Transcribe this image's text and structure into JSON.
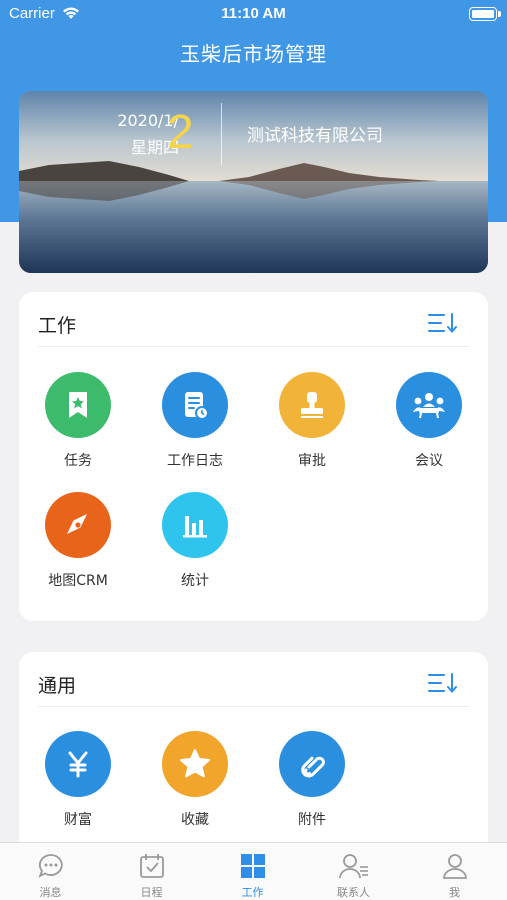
{
  "status_bar": {
    "carrier": "Carrier",
    "time": "11:10 AM"
  },
  "nav": {
    "title": "玉柴后市场管理"
  },
  "banner": {
    "date_line": "2020/1/",
    "weekday": "星期四",
    "day": "2",
    "company": "测试科技有限公司"
  },
  "work_section": {
    "title": "工作",
    "apps": [
      {
        "label": "任务",
        "color": "#3dbb6c",
        "icon": "bookmark-star-icon"
      },
      {
        "label": "工作日志",
        "color": "#2b8fe0",
        "icon": "document-clock-icon"
      },
      {
        "label": "审批",
        "color": "#f1b338",
        "icon": "stamp-icon"
      },
      {
        "label": "会议",
        "color": "#2b8fe0",
        "icon": "meeting-icon"
      },
      {
        "label": "地图CRM",
        "color": "#e8641b",
        "icon": "compass-icon"
      },
      {
        "label": "统计",
        "color": "#2ec4ee",
        "icon": "bar-chart-icon"
      }
    ]
  },
  "common_section": {
    "title": "通用",
    "apps": [
      {
        "label": "财富",
        "color": "#2b8fe0",
        "icon": "yen-icon"
      },
      {
        "label": "收藏",
        "color": "#f1a52b",
        "icon": "star-icon"
      },
      {
        "label": "附件",
        "color": "#2b8fe0",
        "icon": "paperclip-icon"
      }
    ]
  },
  "tabbar": {
    "items": [
      {
        "label": "消息",
        "icon": "chat-bubble-icon",
        "active": false
      },
      {
        "label": "日程",
        "icon": "calendar-check-icon",
        "active": false
      },
      {
        "label": "工作",
        "icon": "grid-icon",
        "active": true
      },
      {
        "label": "联系人",
        "icon": "contacts-icon",
        "active": false
      },
      {
        "label": "我",
        "icon": "person-icon",
        "active": false
      }
    ],
    "active_color": "#2f8fe6"
  },
  "colors": {
    "primary": "#3f97e6",
    "background": "#f1f1f3"
  }
}
